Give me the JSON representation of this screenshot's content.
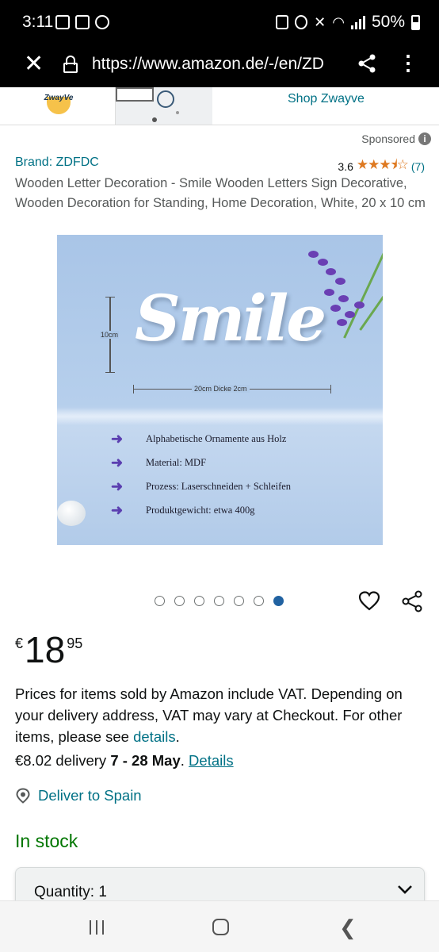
{
  "status_bar": {
    "time": "3:11",
    "battery": "50%",
    "left_icons": [
      "image-icon",
      "calendar-icon",
      "soccer-icon"
    ],
    "right_icons": [
      "data-saver-icon",
      "alarm-icon",
      "mute-icon",
      "wifi-icon",
      "signal-icon",
      "battery-icon"
    ]
  },
  "browser": {
    "url": "https://www.amazon.de/-/en/ZD",
    "close_icon": "close-icon",
    "lock_icon": "lock-icon",
    "share_icon": "share-icon",
    "more_icon": "more-vertical-icon"
  },
  "brand_banner": {
    "logo_text": "ZwayVe",
    "shop_link": "Shop Zwayve"
  },
  "sponsored": {
    "label": "Sponsored",
    "info": "i"
  },
  "product": {
    "brand": "Brand: ZDFDC",
    "rating": "3.6",
    "stars_display": "★★★⯨☆",
    "rating_value": 3.6,
    "rating_count": "(7)",
    "title": "Wooden Letter Decoration - Smile Wooden Letters Sign Decorative, Wooden Decoration for Standing, Home Decoration, White, 20 x 10 cm"
  },
  "image": {
    "word": "Smile",
    "height_label": "10cm",
    "width_label": "20cm  Dicke 2cm",
    "features": [
      "Alphabetische Ornamente aus Holz",
      "Material: MDF",
      "Prozess: Laserschneiden + Schleifen",
      "Produktgewicht: etwa 400g"
    ],
    "arrow_glyph": "➜",
    "colors": {
      "background": "#abc6e8",
      "lavender": "#6a3fb3",
      "arrow": "#5b3fb0"
    }
  },
  "carousel": {
    "count": 7,
    "active_index": 6
  },
  "price": {
    "currency": "€",
    "whole": "18",
    "fraction": "95"
  },
  "vat": {
    "text": "Prices for items sold by Amazon include VAT. Depending on your delivery address, VAT may vary at Checkout. For other items, please see ",
    "link": "details",
    "end": "."
  },
  "delivery": {
    "prefix": "€8.02 delivery ",
    "dates": "7 - 28 May",
    "sep": ". ",
    "link": "Details"
  },
  "deliver_to": "Deliver to Spain",
  "stock": "In stock",
  "quantity": {
    "label": "Quantity: 1"
  },
  "colors": {
    "link": "#007185",
    "in_stock": "#007600",
    "star": "#de7921",
    "carousel_active": "#2162a1"
  }
}
